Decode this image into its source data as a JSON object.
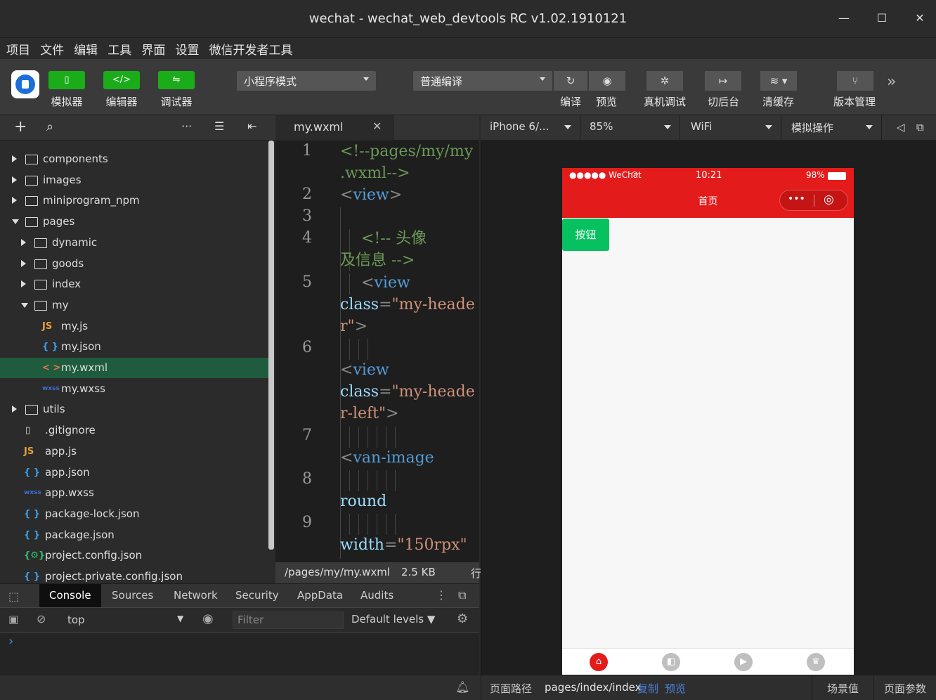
{
  "window": {
    "title": "wechat - wechat_web_devtools RC v1.02.1910121"
  },
  "menu": [
    "项目",
    "文件",
    "编辑",
    "工具",
    "界面",
    "设置",
    "微信开发者工具"
  ],
  "toolbar": {
    "simulator": "模拟器",
    "editor": "编辑器",
    "debugger": "调试器",
    "mode_select": "小程序模式",
    "compile_select": "普通编译",
    "compile": "编译",
    "preview": "预览",
    "remote_debug": "真机调试",
    "background": "切后台",
    "clear_cache": "清缓存",
    "version": "版本管理"
  },
  "file_tree": [
    {
      "name": "components",
      "type": "folder",
      "depth": 0,
      "expanded": false
    },
    {
      "name": "images",
      "type": "folder",
      "depth": 0,
      "expanded": false
    },
    {
      "name": "miniprogram_npm",
      "type": "folder",
      "depth": 0,
      "expanded": false
    },
    {
      "name": "pages",
      "type": "folder",
      "depth": 0,
      "expanded": true
    },
    {
      "name": "dynamic",
      "type": "folder",
      "depth": 1,
      "expanded": false
    },
    {
      "name": "goods",
      "type": "folder",
      "depth": 1,
      "expanded": false
    },
    {
      "name": "index",
      "type": "folder",
      "depth": 1,
      "expanded": false
    },
    {
      "name": "my",
      "type": "folder",
      "depth": 1,
      "expanded": true
    },
    {
      "name": "my.js",
      "type": "js",
      "depth": 2
    },
    {
      "name": "my.json",
      "type": "json",
      "depth": 2
    },
    {
      "name": "my.wxml",
      "type": "wxml",
      "depth": 2,
      "selected": true
    },
    {
      "name": "my.wxss",
      "type": "wxss",
      "depth": 2
    },
    {
      "name": "utils",
      "type": "folder",
      "depth": 0,
      "expanded": false
    },
    {
      "name": ".gitignore",
      "type": "file",
      "depth": 0
    },
    {
      "name": "app.js",
      "type": "js",
      "depth": 0
    },
    {
      "name": "app.json",
      "type": "json",
      "depth": 0
    },
    {
      "name": "app.wxss",
      "type": "wxss",
      "depth": 0
    },
    {
      "name": "package-lock.json",
      "type": "json",
      "depth": 0
    },
    {
      "name": "package.json",
      "type": "json",
      "depth": 0
    },
    {
      "name": "project.config.json",
      "type": "config",
      "depth": 0
    },
    {
      "name": "project.private.config.json",
      "type": "json",
      "depth": 0
    }
  ],
  "file_icon_glyphs": {
    "js": "JS",
    "json": "{ }",
    "wxml": "< >",
    "wxss": "wxss",
    "config": "{⚙}"
  },
  "editor": {
    "tab": "my.wxml",
    "line_numbers": [
      "1",
      "2",
      "3",
      "4",
      "5",
      "6",
      "7",
      "8",
      "9"
    ],
    "status_path": "/pages/my/my.wxml",
    "status_size": "2.5 KB",
    "status_extra": "行"
  },
  "code": {
    "l1a": "<!--pages/my/my",
    "l1b": ".wxml-->",
    "l2_open": "<",
    "l2_tag": "view",
    "l2_close": ">",
    "l4a": "<!-- 头像",
    "l4b": "及信息 -->",
    "l5_tag": "view",
    "l5_attr": "class",
    "l5_val1": "\"my-heade",
    "l5_val2": "r\"",
    "l6_tag": "view",
    "l6_attr": "class",
    "l6_val1": "\"my-heade",
    "l6_val2": "r-left\"",
    "l7_tag": "van-image",
    "l8_attr": "round",
    "l9_attr": "width",
    "l9_val": "\"150rpx\"",
    "lt": "<",
    "gt": ">",
    "eq": "="
  },
  "devtools": {
    "tabs": [
      "Console",
      "Sources",
      "Network",
      "Security",
      "AppData",
      "Audits"
    ],
    "context": "top",
    "filter_placeholder": "Filter",
    "levels": "Default levels ▼",
    "prompt": "›"
  },
  "simulator": {
    "device": "iPhone 6/...",
    "zoom": "85%",
    "network": "WiFi",
    "operation": "模拟操作"
  },
  "phone": {
    "carrier": "●●●●● WeChat",
    "time": "10:21",
    "battery": "98%",
    "nav_title": "首页",
    "button": "按钮",
    "tab_colors": {
      "active": "#e31b1b",
      "inactive": "#bfbfbf"
    }
  },
  "status_bar": {
    "path_label": "页面路径",
    "path": "pages/index/index",
    "copy": "复制",
    "preview": "预览",
    "scene": "场景值",
    "params": "页面参数"
  }
}
